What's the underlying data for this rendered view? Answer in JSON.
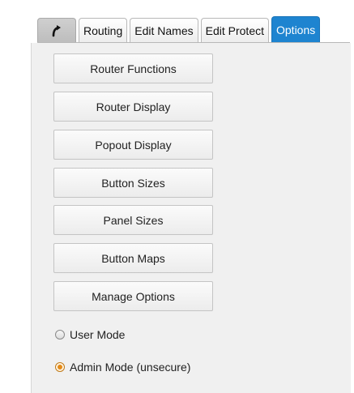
{
  "tabs": [
    {
      "label": "",
      "icon": "curved-arrow-icon",
      "active": false
    },
    {
      "label": "Routing",
      "active": false
    },
    {
      "label": "Edit Names",
      "active": false
    },
    {
      "label": "Edit Protect",
      "active": false
    },
    {
      "label": "Options",
      "active": true
    }
  ],
  "options_panel": {
    "buttons": [
      "Router Functions",
      "Router Display",
      "Popout Display",
      "Button Sizes",
      "Panel Sizes",
      "Button Maps",
      "Manage Options"
    ],
    "mode": {
      "user_label": "User Mode",
      "admin_label": "Admin Mode (unsecure)",
      "selected": "admin"
    }
  },
  "colors": {
    "active_tab": "#1e84d0",
    "radio_selected": "#e48a17",
    "panel_background": "#f0f0f0"
  }
}
